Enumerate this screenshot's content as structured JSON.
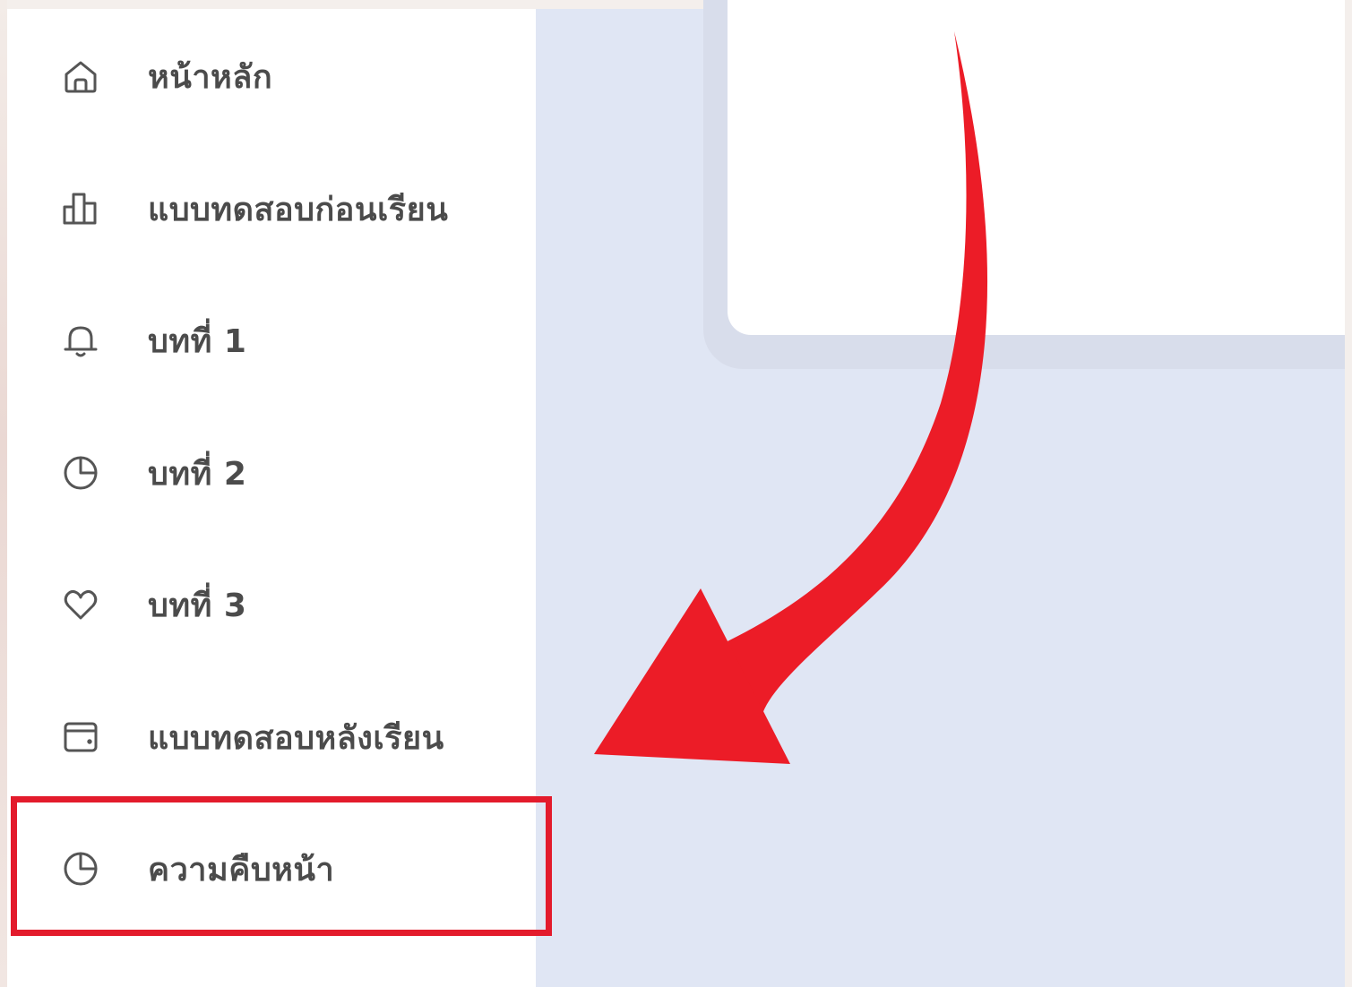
{
  "sidebar": {
    "items": [
      {
        "label": "หน้าหลัก",
        "icon": "home-icon"
      },
      {
        "label": "แบบทดสอบก่อนเรียน",
        "icon": "bar-chart-icon"
      },
      {
        "label": "บทที่ 1",
        "icon": "bell-icon"
      },
      {
        "label": "บทที่ 2",
        "icon": "pie-chart-icon"
      },
      {
        "label": "บทที่ 3",
        "icon": "heart-icon"
      },
      {
        "label": "แบบทดสอบหลังเรียน",
        "icon": "wallet-icon"
      },
      {
        "label": "ความคืบหน้า",
        "icon": "pie-chart-icon"
      }
    ],
    "highlighted_item": "ความคืบหน้า"
  },
  "colors": {
    "sidebar_bg": "#ffffff",
    "main_bg": "#e0e6f4",
    "label_text": "#4b4b4b",
    "icon_stroke": "#555555",
    "annotation_red": "#e31b2c"
  },
  "annotation": {
    "arrow_icon": "curved-arrow-icon",
    "highlight": "highlight-box"
  }
}
